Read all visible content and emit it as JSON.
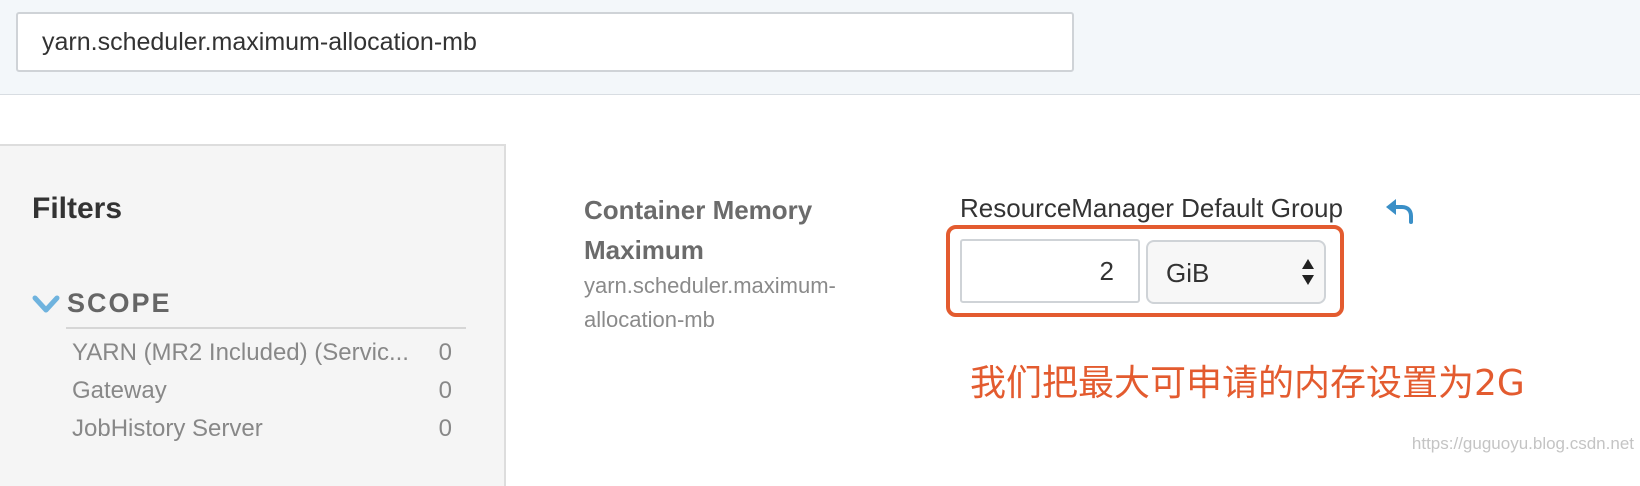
{
  "search": {
    "value": "yarn.scheduler.maximum-allocation-mb"
  },
  "filters": {
    "title": "Filters",
    "scope": {
      "label": "SCOPE",
      "items": [
        {
          "label": "YARN (MR2 Included) (Servic...",
          "count": "0"
        },
        {
          "label": "Gateway",
          "count": "0"
        },
        {
          "label": "JobHistory Server",
          "count": "0"
        }
      ]
    }
  },
  "property": {
    "title_line1": "Container Memory",
    "title_line2": "Maximum",
    "key_line1": "yarn.scheduler.maximum-",
    "key_line2": "allocation-mb",
    "group": "ResourceManager Default Group",
    "value": "2",
    "unit": "GiB"
  },
  "annotation": {
    "text": "我们把最大可申请的内存设置为2G",
    "color": "#e35b2f"
  },
  "watermark": "https://guguoyu.blog.csdn.net",
  "colors": {
    "accent": "#3a8fc7",
    "annotation": "#e35b2f"
  },
  "icons": {
    "scope_toggle": "chevron-down-icon",
    "revert": "undo-icon",
    "select": "select-arrows-icon"
  }
}
